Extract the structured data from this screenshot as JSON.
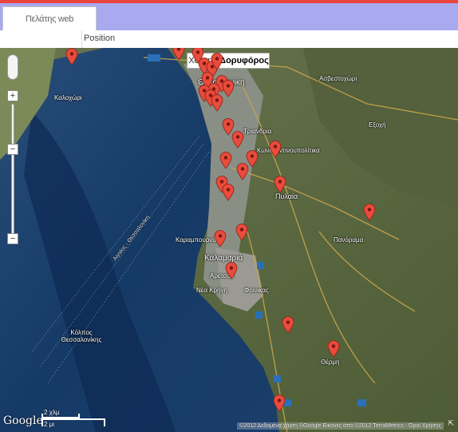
{
  "app": {
    "tab_label": "Πελάτης web",
    "subheader_label": "Position"
  },
  "map": {
    "type_buttons": [
      {
        "label": "Χάρτης",
        "active": false
      },
      {
        "label": "Δορυφόρος",
        "active": true
      }
    ],
    "zoom_in": "+",
    "zoom_out": "−",
    "place_labels": [
      "Καλοχώρι",
      "Θεσσαλονίκη",
      "Ασβεστοχώρι",
      "Εξοχή",
      "Τριανδρία",
      "Κωνσταντινουπολίτικα",
      "Πυλαία",
      "Πανόραμα",
      "Καραμπουρνάκι",
      "Καλαμαριά",
      "Αρετσού",
      "Νέα Κρήνη",
      "Φοίνικας",
      "Θέρμη",
      "Αιγαίος - Θεσσαλονίκη",
      "Κόλπος Θεσσαλονίκης"
    ],
    "scale": {
      "km": "2 χλμ",
      "mi": "2 μι"
    },
    "logo": "Google",
    "copyright": "©2012 Δεδομένα χάρτη ©Google Εικόνες από ©2012 TerraMetrics - Όροι Χρήσης",
    "corner_icon": "expand-corner-icon",
    "colors": {
      "pin": "#e74c3c",
      "sea": "#163a66",
      "land": "#5e6e44"
    }
  }
}
